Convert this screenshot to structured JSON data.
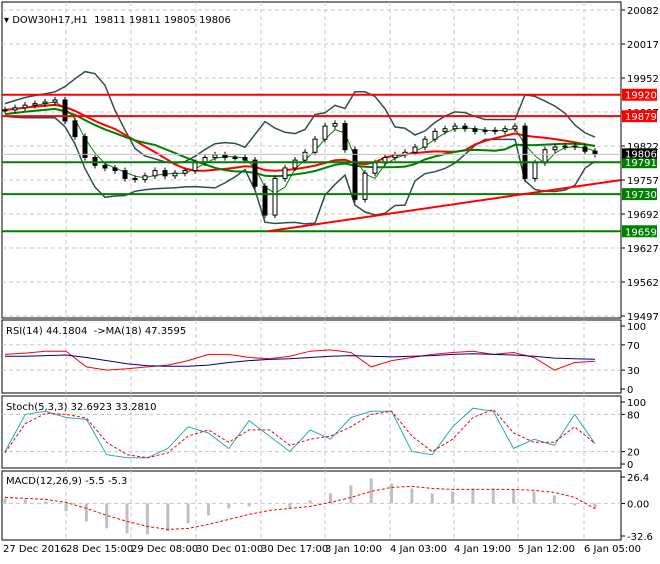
{
  "header": {
    "symbol": "DOW30H17,H1",
    "ohlc": "19811 19811 19805 19806"
  },
  "colors": {
    "up_candle": "#000000",
    "resistance": "#ff0000",
    "support": "#008000",
    "bb": "#2f4f4f",
    "ma_fast": "#008000",
    "ma_slow": "#ff0000",
    "rsi": "#ff0000",
    "rsi_ma": "#000080",
    "stoch_main": "#20b2aa",
    "stoch_signal": "#ff0000",
    "macd_hist": "#c0c0c0",
    "macd_signal": "#ff0000"
  },
  "chart_data": [
    {
      "type": "line",
      "title": "DOW30H17,H1",
      "ylim": [
        19497,
        20082
      ],
      "y_ticks": [
        "20082",
        "20017",
        "19952",
        "19887",
        "19822",
        "19757",
        "19692",
        "19627",
        "19562",
        "19497"
      ],
      "x_ticks": [
        "27 Dec 2016",
        "28 Dec 15:00",
        "29 Dec 08:00",
        "30 Dec 01:00",
        "30 Dec 17:00",
        "3 Jan 10:00",
        "4 Jan 03:00",
        "4 Jan 19:00",
        "5 Jan 12:00",
        "6 Jan 05:00"
      ],
      "closes": [
        19891,
        19895,
        19900,
        19903,
        19906,
        19910,
        19870,
        19840,
        19800,
        19785,
        19780,
        19775,
        19760,
        19758,
        19765,
        19775,
        19765,
        19770,
        19775,
        19790,
        19800,
        19805,
        19800,
        19800,
        19795,
        19745,
        19690,
        19760,
        19780,
        19795,
        19810,
        19835,
        19860,
        19865,
        19815,
        19720,
        19770,
        19790,
        19800,
        19805,
        19810,
        19820,
        19835,
        19850,
        19855,
        19860,
        19855,
        19850,
        19852,
        19850,
        19855,
        19860,
        19760,
        19790,
        19815,
        19820,
        19822,
        19820,
        19812,
        19806
      ],
      "levels": [
        {
          "value": 19920,
          "label": "19920",
          "kind": "resistance"
        },
        {
          "value": 19879,
          "label": "19879",
          "kind": "resistance"
        },
        {
          "value": 19791,
          "label": "19791",
          "kind": "support"
        },
        {
          "value": 19730,
          "label": "19730",
          "kind": "support"
        },
        {
          "value": 19659,
          "label": "19659",
          "kind": "support"
        }
      ],
      "trendline": {
        "from": 19659,
        "to": 19757
      },
      "current_price": "19806"
    },
    {
      "type": "line",
      "title": "RSI(14) 44.1804  ->MA(18) 47.3595",
      "ylim": [
        0,
        100
      ],
      "y_ticks": [
        "100",
        "70",
        "30",
        "0"
      ],
      "series": [
        {
          "name": "RSI(14)",
          "values": [
            55,
            57,
            60,
            60,
            35,
            30,
            32,
            35,
            38,
            45,
            55,
            55,
            50,
            48,
            52,
            60,
            62,
            58,
            35,
            45,
            50,
            55,
            58,
            60,
            55,
            58,
            50,
            30,
            42,
            44.18
          ]
        },
        {
          "name": "MA(18)",
          "values": [
            52,
            52,
            53,
            54,
            50,
            45,
            40,
            37,
            36,
            36,
            38,
            42,
            45,
            47,
            48,
            50,
            52,
            53,
            52,
            51,
            52,
            53,
            55,
            56,
            55,
            54,
            52,
            49,
            48,
            47.36
          ]
        }
      ]
    },
    {
      "type": "line",
      "title": "Stoch(5,3,3) 32.6923 33.2810",
      "ylim": [
        0,
        100
      ],
      "y_ticks": [
        "100",
        "80",
        "20",
        "0"
      ],
      "series": [
        {
          "name": "Stoch main",
          "values": [
            20,
            80,
            85,
            75,
            72,
            15,
            10,
            10,
            25,
            60,
            50,
            25,
            70,
            45,
            20,
            55,
            40,
            75,
            85,
            85,
            20,
            15,
            60,
            90,
            85,
            25,
            40,
            30,
            80,
            32.69
          ]
        },
        {
          "name": "Stoch signal",
          "values": [
            18,
            65,
            82,
            80,
            74,
            35,
            15,
            10,
            18,
            45,
            55,
            35,
            55,
            55,
            30,
            40,
            45,
            60,
            80,
            85,
            45,
            20,
            40,
            75,
            88,
            50,
            35,
            35,
            60,
            33.28
          ]
        }
      ]
    },
    {
      "type": "bar",
      "title": "MACD(12,26,9) -5.5 -5.3",
      "ylim": [
        -32.6,
        26.4
      ],
      "y_ticks": [
        "26.4",
        "0.00",
        "-32.6"
      ],
      "series": [
        {
          "name": "MACD",
          "values": [
            5,
            4,
            2,
            -8,
            -18,
            -25,
            -30,
            -31,
            -28,
            -20,
            -12,
            -5,
            -3,
            0,
            -5,
            3,
            10,
            18,
            25,
            20,
            15,
            10,
            12,
            15,
            15,
            14,
            12,
            8,
            -2,
            -5.5
          ]
        },
        {
          "name": "Signal",
          "values": [
            6,
            5,
            4,
            1,
            -5,
            -12,
            -18,
            -23,
            -26,
            -25,
            -21,
            -16,
            -11,
            -7,
            -5,
            -3,
            1,
            6,
            12,
            16,
            17,
            15,
            14,
            14,
            14,
            14,
            13,
            11,
            6,
            -5.3
          ]
        }
      ]
    }
  ]
}
